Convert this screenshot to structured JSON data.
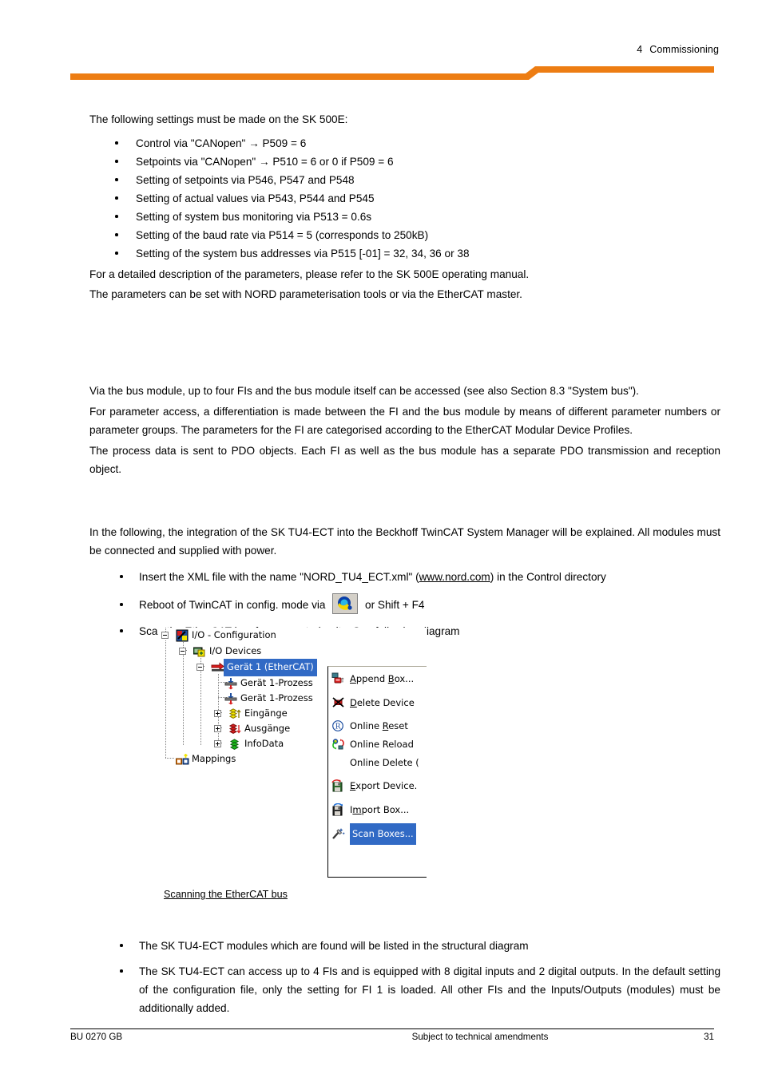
{
  "header": {
    "chapter_number": "4",
    "chapter_title": "Commissioning",
    "accent_color": "#ED7D13"
  },
  "intro": {
    "lead": "The following settings must be made on the SK 500E:",
    "bullets": [
      "Control via \"CANopen\" → P509 = 6",
      "Setpoints via \"CANopen\" → P510 = 6 or 0 if P509 = 6",
      "Setting of setpoints via P546, P547 and P548",
      "Setting of actual values via P543, P544 and P545",
      "Setting of system bus monitoring via P513 = 0.6s",
      "Setting of the baud rate via P514 = 5 (corresponds to 250kB)",
      "Setting of the system bus addresses via P515 [-01] = 32, 34, 36 or 38"
    ],
    "after_1": "For a detailed description of the parameters, please refer to the SK 500E operating manual.",
    "after_2": "The parameters can be set with NORD parameterisation tools or via the EtherCAT master."
  },
  "section_bus": {
    "p1": "Via the bus module, up to four FIs and the bus module itself can be accessed (see also Section 8.3  \"System bus\").",
    "p2": "For parameter access, a differentiation is made between the FI and the bus module by means of different parameter numbers or parameter groups. The parameters for the FI are categorised according to the EtherCAT Modular Device Profiles.",
    "p3": "The process data is sent to PDO objects. Each FI as well as the bus module has a separate PDO transmission and reception object."
  },
  "section_twincat": {
    "p1": "In the following, the integration of the SK TU4-ECT into the Beckhoff TwinCAT System Manager will be explained. All modules must be connected and supplied with power.",
    "bullet_1_a": "Insert the XML file with the name \"NORD_TU4_ECT.xml\" (",
    "bullet_1_link": "www.nord.com",
    "bullet_1_b": ") in the Control directory",
    "bullet_2_a": "Reboot of TwinCAT in config. mode via",
    "bullet_2_b": "or Shift + F4",
    "bullet_3": "Scan the EtherCAT bus for connected units. See following diagram"
  },
  "screenshot": {
    "tree": [
      {
        "label": "I/O - Configuration",
        "icon": "io-configuration-icon",
        "expander": "minus"
      },
      {
        "label": "I/O Devices",
        "icon": "io-devices-icon",
        "expander": "minus"
      },
      {
        "label": "Gerät 1 (EtherCAT)",
        "icon": "ethercat-device-icon",
        "expander": "minus",
        "selected": true
      },
      {
        "label": "Gerät 1-Prozess",
        "icon": "process-image-in-icon",
        "expander": "none"
      },
      {
        "label": "Gerät 1-Prozess",
        "icon": "process-image-out-icon",
        "expander": "none"
      },
      {
        "label": "Eingänge",
        "icon": "inputs-icon",
        "expander": "plus"
      },
      {
        "label": "Ausgänge",
        "icon": "outputs-icon",
        "expander": "plus"
      },
      {
        "label": "InfoData",
        "icon": "infodata-icon",
        "expander": "plus"
      },
      {
        "label": "Mappings",
        "icon": "mappings-icon",
        "expander": "none"
      }
    ],
    "context_menu": [
      {
        "label": "Append Box...",
        "accel": "B",
        "icon": "append-box-icon"
      },
      {
        "label": "Delete Device",
        "accel": "D",
        "icon": "delete-device-icon"
      },
      {
        "label": "Online Reset",
        "accel": "R",
        "icon": "online-reset-icon"
      },
      {
        "label": "Online Reload",
        "accel": "",
        "icon": "online-reload-icon"
      },
      {
        "label": "Online Delete (",
        "accel": "",
        "icon": "none"
      },
      {
        "label": "Export Device.",
        "accel": "E",
        "icon": "export-device-icon"
      },
      {
        "label": "Import Box...",
        "accel": "m",
        "icon": "import-box-icon"
      },
      {
        "label": "Scan Boxes...",
        "accel": "",
        "icon": "scan-boxes-icon",
        "selected": true
      }
    ],
    "selection_color": "#316ac5",
    "caption": "Scanning the EtherCAT bus"
  },
  "closing": {
    "bullet_1": "The SK TU4-ECT modules which are found will be listed in the structural diagram",
    "bullet_2": "The SK TU4-ECT can access up to 4 FIs and is equipped with 8 digital inputs and 2 digital outputs.  In the default setting of the configuration file, only the setting for FI 1 is loaded. All other FIs and the Inputs/Outputs (modules) must be additionally added."
  },
  "footer": {
    "left": "BU 0270 GB",
    "center": "Subject to technical amendments",
    "right": "31"
  }
}
